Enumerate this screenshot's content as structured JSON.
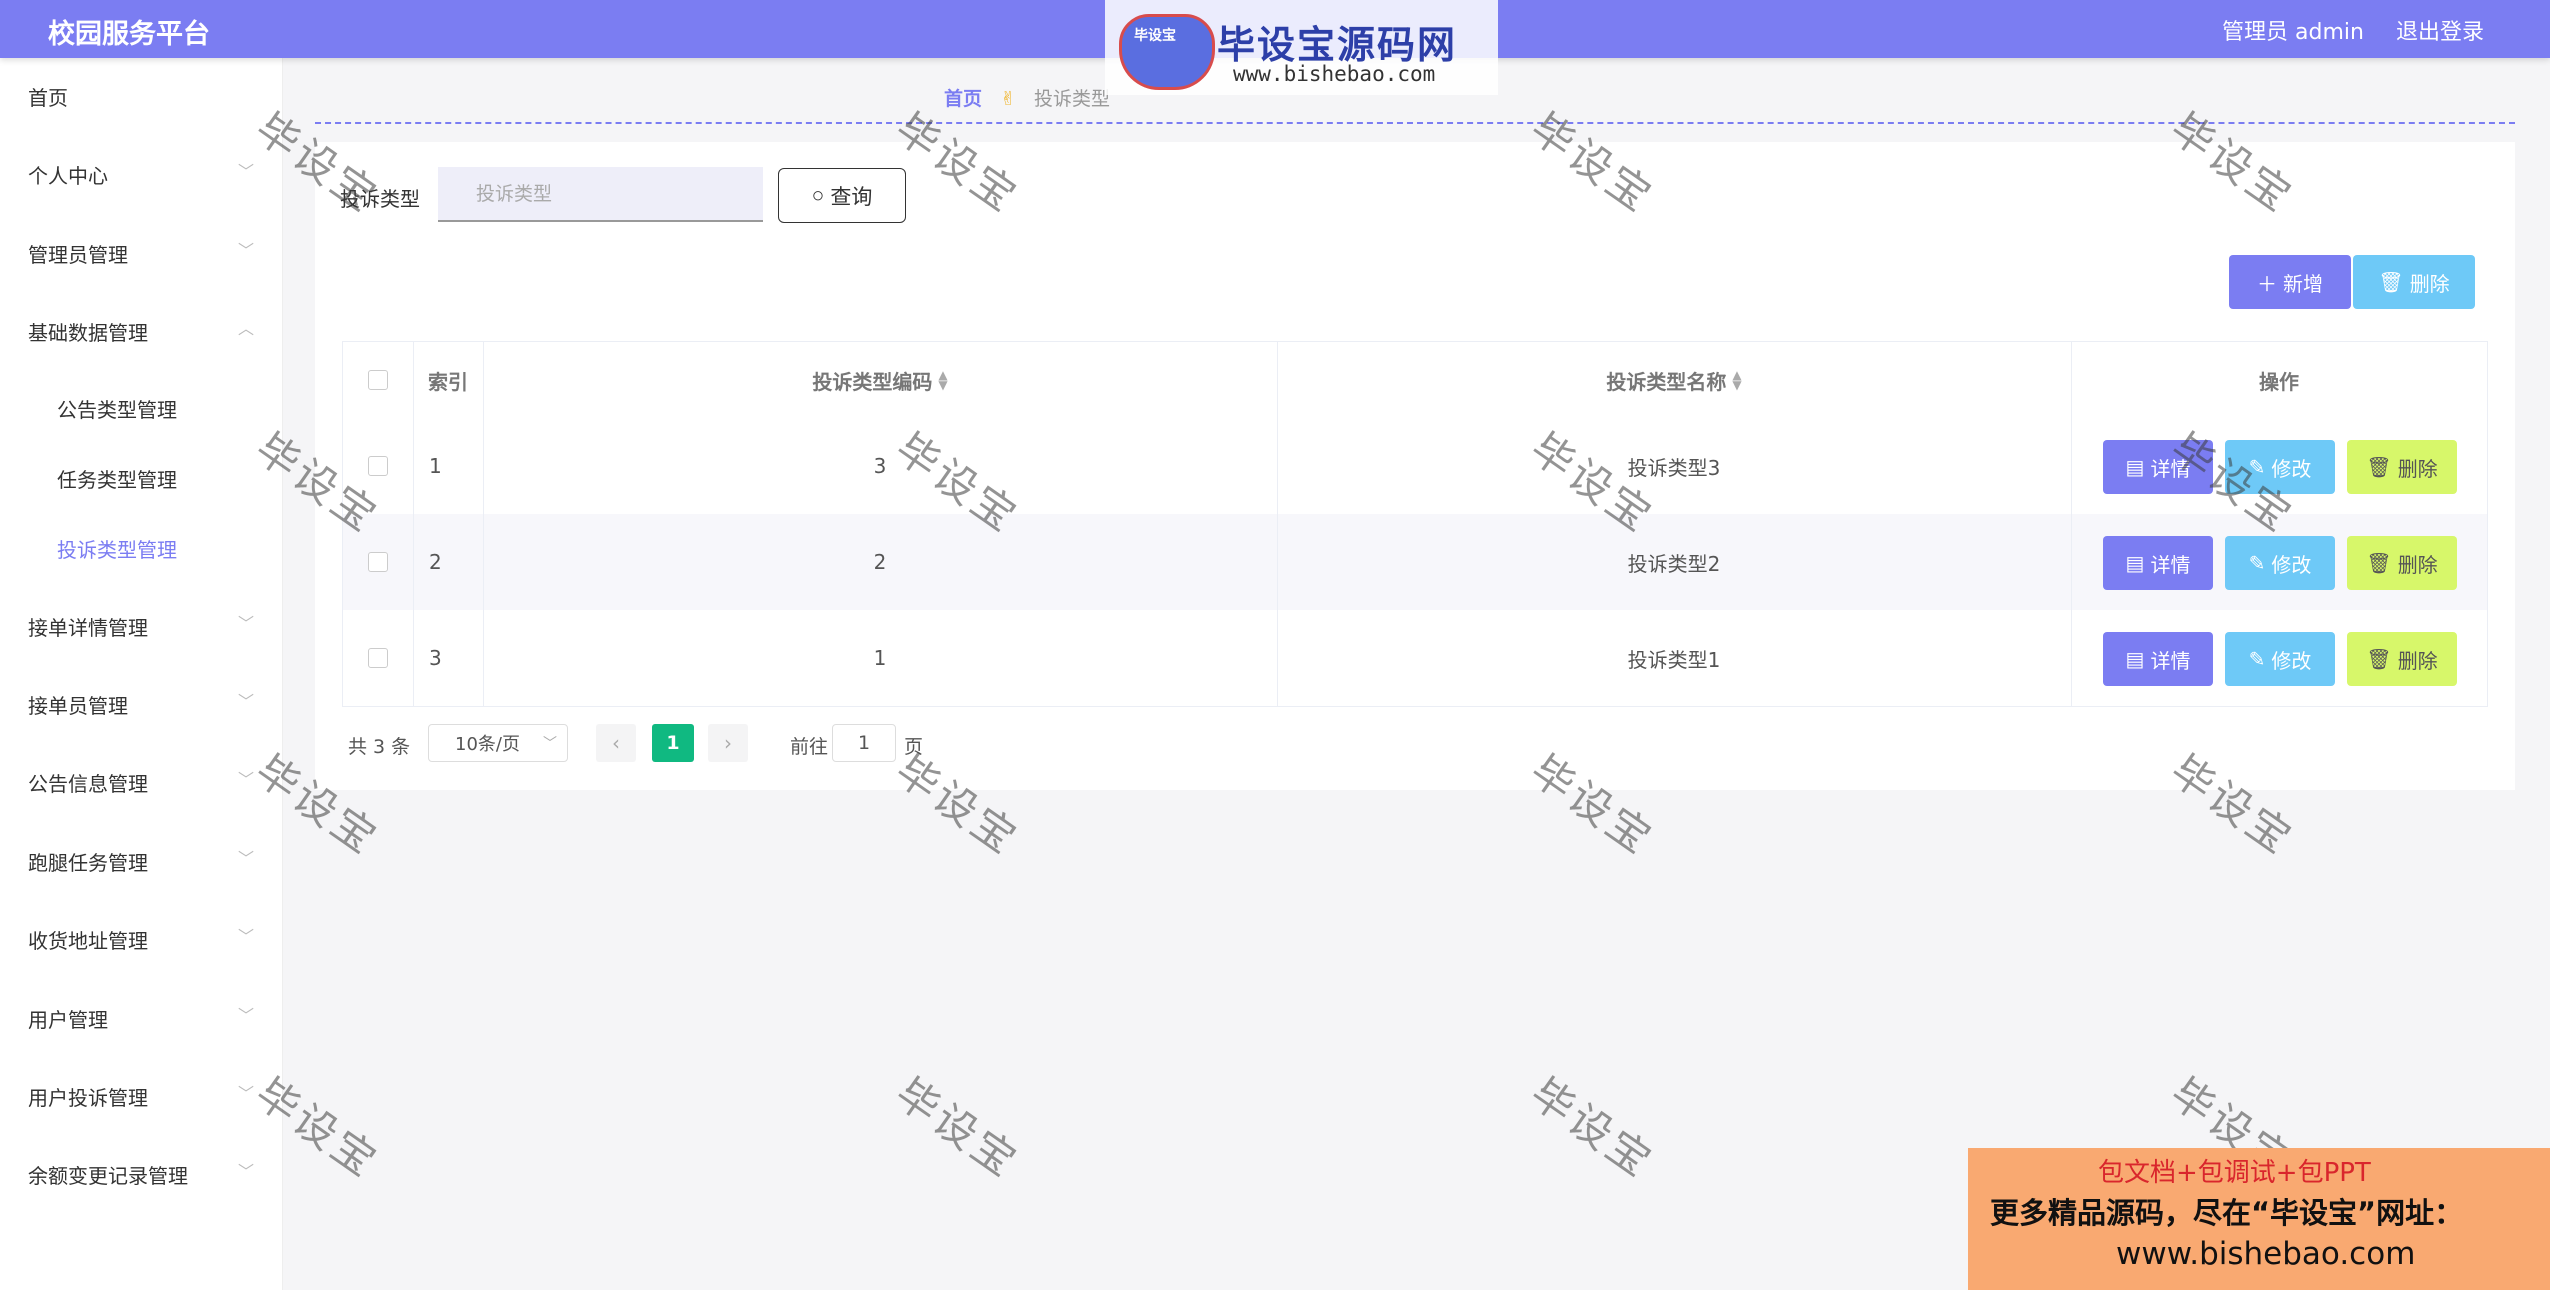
{
  "header": {
    "title": "校园服务平台",
    "user": "管理员 admin",
    "logout": "退出登录"
  },
  "logo": {
    "mascot_text": "毕设宝",
    "brand": "毕设宝源码网",
    "url": "www.bishebao.com"
  },
  "sidebar": {
    "items": [
      {
        "label": "首页"
      },
      {
        "label": "个人中心"
      },
      {
        "label": "管理员管理"
      },
      {
        "label": "基础数据管理"
      },
      {
        "label": "接单详情管理"
      },
      {
        "label": "接单员管理"
      },
      {
        "label": "公告信息管理"
      },
      {
        "label": "跑腿任务管理"
      },
      {
        "label": "收货地址管理"
      },
      {
        "label": "用户管理"
      },
      {
        "label": "用户投诉管理"
      },
      {
        "label": "余额变更记录管理"
      }
    ],
    "subitems": [
      {
        "label": "公告类型管理"
      },
      {
        "label": "任务类型管理"
      },
      {
        "label": "投诉类型管理"
      }
    ]
  },
  "breadcrumb": {
    "home": "首页",
    "current": "投诉类型"
  },
  "search": {
    "label": "投诉类型",
    "placeholder": "投诉类型",
    "query_button": "查询"
  },
  "toolbar": {
    "add_label": "新增",
    "delete_label": "删除"
  },
  "table": {
    "columns": {
      "index": "索引",
      "code": "投诉类型编码",
      "name": "投诉类型名称",
      "actions": "操作"
    },
    "rows": [
      {
        "index": "1",
        "code": "3",
        "name": "投诉类型3"
      },
      {
        "index": "2",
        "code": "2",
        "name": "投诉类型2"
      },
      {
        "index": "3",
        "code": "1",
        "name": "投诉类型1"
      }
    ],
    "row_actions": {
      "detail": "详情",
      "edit": "修改",
      "delete": "删除"
    }
  },
  "pagination": {
    "total": "共 3 条",
    "page_size": "10条/页",
    "current_page": "1",
    "goto_label": "前往",
    "goto_value": "1",
    "goto_unit": "页"
  },
  "watermark": {
    "text": "毕设宝"
  },
  "promo": {
    "line1": "包文档+包调试+包PPT",
    "line2": "更多精品源码，尽在“毕设宝”网址：",
    "line3": "www.bishebao.com"
  },
  "colors": {
    "primary": "#7b7df2",
    "info": "#6ec9f7",
    "warning": "#d7f76a",
    "success": "#10b981"
  }
}
